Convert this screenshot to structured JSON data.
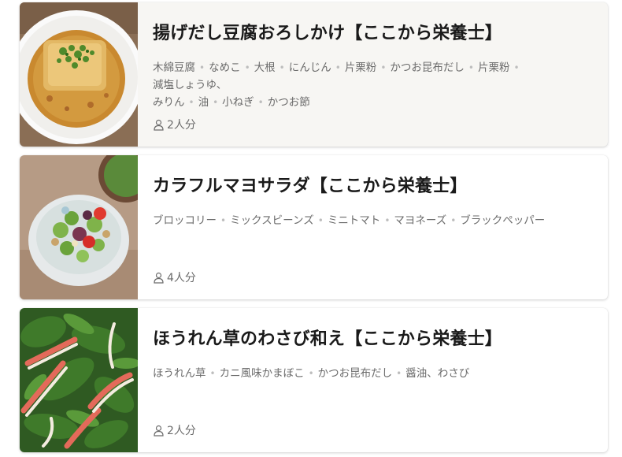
{
  "recipes": [
    {
      "title": "揚げだし豆腐おろしかけ【ここから栄養士】",
      "ingredients": [
        "木綿豆腐",
        "なめこ",
        "大根",
        "にんじん",
        "片栗粉",
        "かつお昆布だし",
        "片栗粉",
        "減塩しょうゆ、",
        "みりん",
        "油",
        "小ねぎ",
        "かつお節"
      ],
      "servings": "2人分",
      "image_icon": "agedashi-tofu-photo"
    },
    {
      "title": "カラフルマヨサラダ【ここから栄養士】",
      "ingredients": [
        "ブロッコリー",
        "ミックスビーンズ",
        "ミニトマト",
        "マヨネーズ",
        "ブラックペッパー"
      ],
      "servings": "4人分",
      "image_icon": "mayo-salad-photo"
    },
    {
      "title": "ほうれん草のわさび和え【ここから栄養士】",
      "ingredients": [
        "ほうれん草",
        "カニ風味かまぼこ",
        "かつお昆布だし",
        "醤油、わさび"
      ],
      "servings": "2人分",
      "image_icon": "spinach-wasabi-photo"
    }
  ],
  "colors": {
    "title": "#1a1a1a",
    "meta": "#6b6b6b",
    "separator": "#bdbdbd",
    "highlight_card": "#f7f6f3"
  }
}
